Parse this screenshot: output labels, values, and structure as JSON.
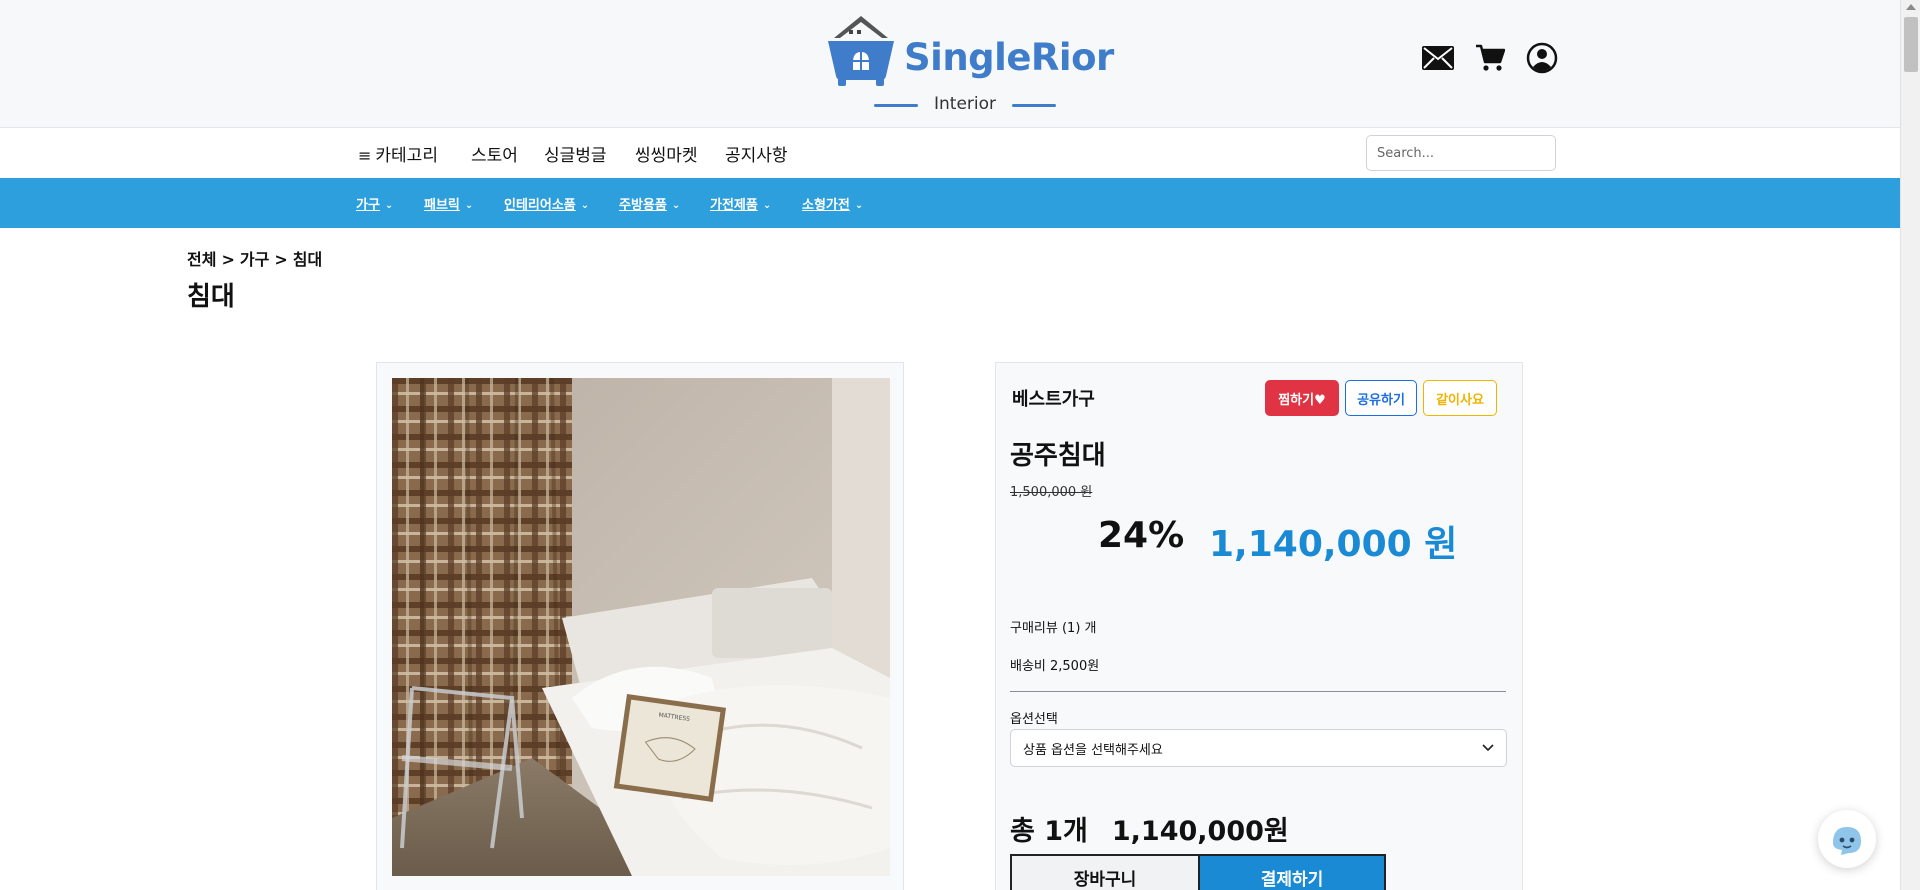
{
  "brand": {
    "name": "SingleRior",
    "subtitle": "Interior",
    "accent_color": "#3f7cc9"
  },
  "header": {
    "icons": [
      "mail-icon",
      "cart-icon",
      "user-icon"
    ]
  },
  "top_nav": {
    "menu_icon": "≡",
    "items": [
      "카테고리",
      "스토어",
      "싱글벙글",
      "씽씽마켓",
      "공지사항"
    ],
    "search_placeholder": "Search..."
  },
  "category_bar": {
    "color": "#2d9fdc",
    "items": [
      "가구",
      "패브릭",
      "인테리어소품",
      "주방용품",
      "가전제품",
      "소형가전"
    ]
  },
  "breadcrumb": {
    "items": [
      "전체",
      "가구",
      "침대"
    ],
    "separator": ">"
  },
  "page_title": "침대",
  "product": {
    "brand": "베스트가구",
    "like_label": "찜하기♥",
    "share_label": "공유하기",
    "group_buy_label": "같이사요",
    "name": "공주침대",
    "original_price": "1,500,000 원",
    "discount": "24%",
    "sale_price": "1,140,000 원",
    "reviews": "구매리뷰 (1) 개",
    "shipping": "배송비 2,500원",
    "option_label": "옵션선택",
    "option_placeholder": "상품 옵션을 선택해주세요",
    "total_label": "총 1개",
    "total_amount": "1,140,000원",
    "cart_button": "장바구니",
    "pay_button": "결제하기",
    "photo_caption": "MATTRESS"
  },
  "colors": {
    "like": "#e03344",
    "share": "#1d6ee0",
    "group_buy": "#f0b400",
    "price": "#1a8ad4"
  }
}
